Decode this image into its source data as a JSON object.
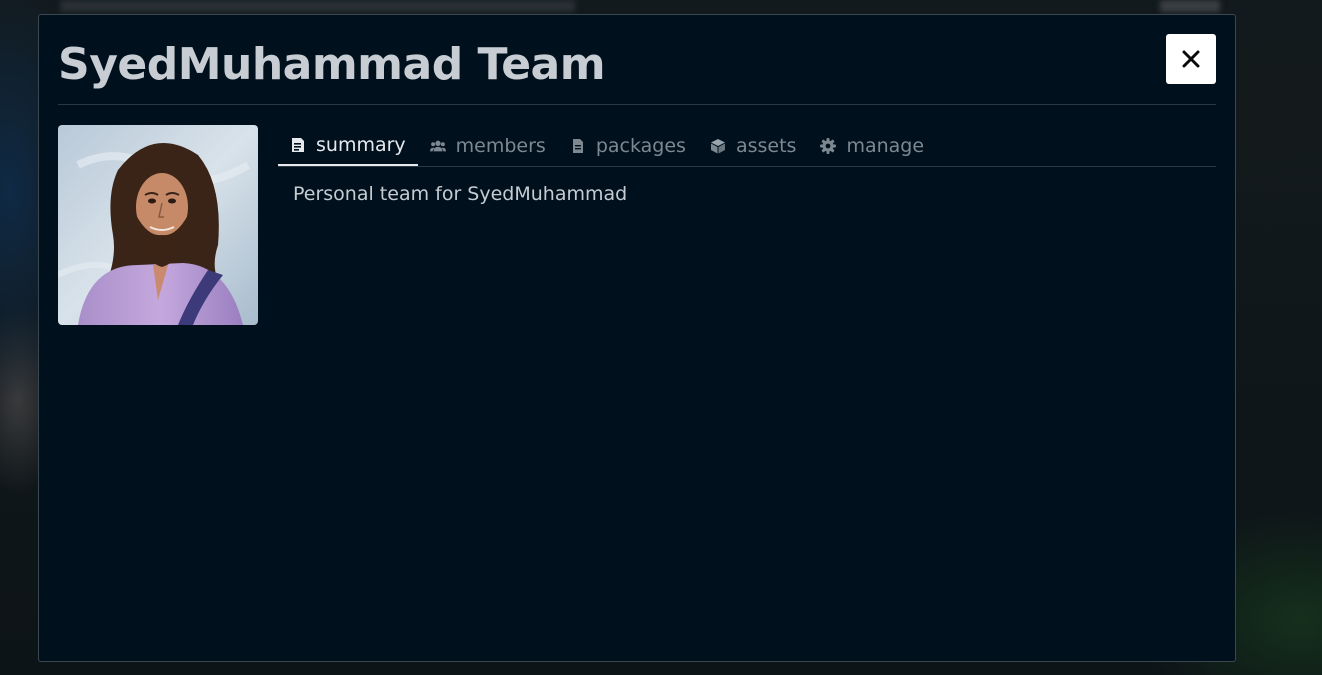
{
  "modal": {
    "title": "SyedMuhammad Team",
    "close_icon": "close-icon"
  },
  "avatar": {
    "alt": "Team avatar"
  },
  "tabs": [
    {
      "label": "summary",
      "icon": "document-icon",
      "active": true
    },
    {
      "label": "members",
      "icon": "users-icon",
      "active": false
    },
    {
      "label": "packages",
      "icon": "file-icon",
      "active": false
    },
    {
      "label": "assets",
      "icon": "cube-icon",
      "active": false
    },
    {
      "label": "manage",
      "icon": "gear-icon",
      "active": false
    }
  ],
  "summary": {
    "text": "Personal team for SyedMuhammad"
  },
  "colors": {
    "modal_bg": "#01101d",
    "title": "#c7cdd3",
    "tab_inactive": "#7d8891",
    "tab_active": "#e6eaee"
  }
}
